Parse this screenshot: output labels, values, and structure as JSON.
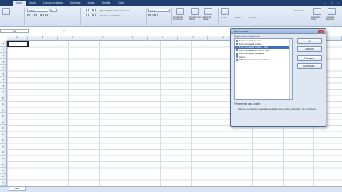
{
  "ribbon_tabs": [
    "Início",
    "Inserir",
    "Layout da página",
    "Fórmulas",
    "Dados",
    "Revisão",
    "Exibir"
  ],
  "active_tab_index": 0,
  "ribbon": {
    "font_name": "Calibri",
    "font_size": "11",
    "wrap_text": "Quebrar Texto Automaticamente",
    "merge_center": "Mesclar e Centralizar",
    "number_format": "Geral",
    "conditional_formatting": "Formatação Condicional",
    "format_as_table": "Formatar como Tabela",
    "cell_styles": "Estilos de Célula",
    "insert": "Inserir",
    "delete": "Excluir",
    "format": "Formatar",
    "autosum": "AutoSoma",
    "sort_filter": "Classificar e Filtrar",
    "find_select": "Localizar e Selecionar"
  },
  "formula_bar": {
    "name_box": "A1",
    "fx": "fx",
    "value": ""
  },
  "columns": [
    "A",
    "B",
    "C",
    "D",
    "E",
    "F",
    "G",
    "H",
    "I",
    "J",
    "K"
  ],
  "rows": [
    "1",
    "2",
    "3",
    "4",
    "5",
    "6",
    "7",
    "8",
    "9",
    "10",
    "11",
    "12",
    "13",
    "14",
    "15",
    "16",
    "17",
    "18",
    "19",
    "20",
    "21",
    "22",
    "23",
    "24"
  ],
  "sheet_tab": "Plan1",
  "dialog": {
    "title": "Suplementos",
    "list_label": "Suplementos disponíveis:",
    "items": [
      "Ferramentas para euro",
      "Ferramentas de análise",
      "Ferramentas de análise - VBA",
      "Ferramentas para o Euro - VBA",
      "Ferramentas de pesquisa",
      "Solver",
      "XML de Assistente para Internet"
    ],
    "selected_index": 2,
    "buttons": {
      "ok": "OK",
      "cancel": "Cancelar",
      "browse": "Procurar...",
      "automation": "Automação..."
    },
    "desc_title": "Ferramentas para análise",
    "desc": "Fornece ferramentas de análise de dados para análise estatística e de engenharia."
  }
}
